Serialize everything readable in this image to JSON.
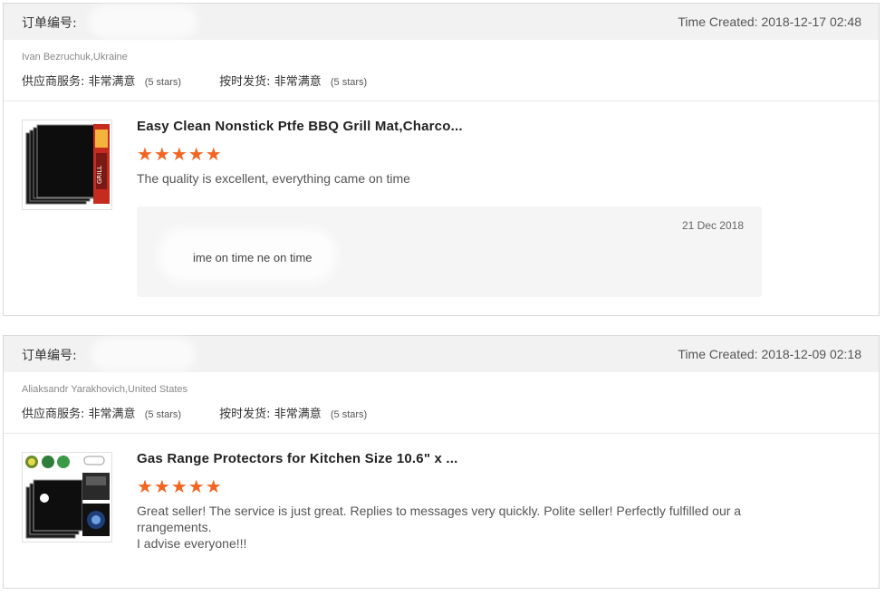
{
  "orders": [
    {
      "order_label": "订单编号:",
      "time_created": "Time Created: 2018-12-17 02:48",
      "buyer": "Ivan Bezruchuk,Ukraine",
      "supplier_service_label": "供应商服务:",
      "supplier_service_value": "非常满意",
      "supplier_service_stars": "(5 stars)",
      "shipping_label": "按时发货:",
      "shipping_value": "非常满意",
      "shipping_stars": "(5 stars)",
      "product_title": "Easy Clean Nonstick Ptfe BBQ Grill Mat,Charco...",
      "rating_stars": "★★★★★",
      "feedback": "The quality is excellent, everything came on time",
      "reply_date": "21 Dec 2018",
      "reply_text": "ime on time  ne on time",
      "thumb_icon": "grill-mat-product-image"
    },
    {
      "order_label": "订单编号:",
      "time_created": "Time Created: 2018-12-09 02:18",
      "buyer": "Aliaksandr Yarakhovich,United States",
      "supplier_service_label": "供应商服务:",
      "supplier_service_value": "非常满意",
      "supplier_service_stars": "(5 stars)",
      "shipping_label": "按时发货:",
      "shipping_value": "非常满意",
      "shipping_stars": "(5 stars)",
      "product_title": "Gas Range Protectors for Kitchen Size 10.6\" x ...",
      "rating_stars": "★★★★★",
      "feedback": "Great seller! The service is just great. Replies to messages very quickly. Polite seller! Perfectly fulfilled our a rrangements.\nI advise everyone!!!",
      "thumb_icon": "gas-range-protector-product-image"
    }
  ],
  "colors": {
    "header_bg": "#f2f2f2",
    "star": "#f26522",
    "reply_bg": "#f5f5f5",
    "border": "#d9d9d9"
  }
}
